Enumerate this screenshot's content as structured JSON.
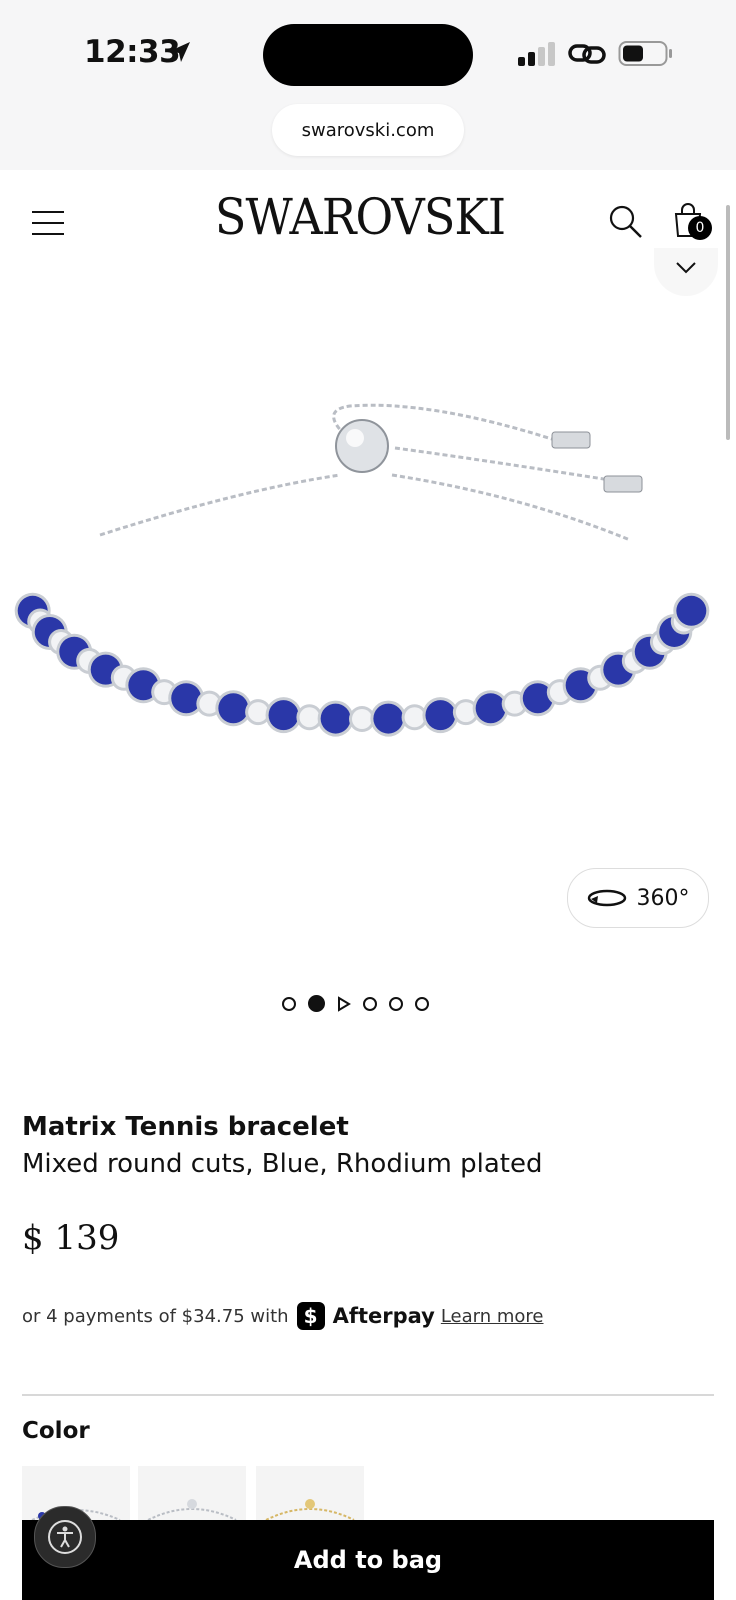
{
  "status_bar": {
    "time": "12:33",
    "url": "swarovski.com"
  },
  "header": {
    "logo": "SWAROVSKI",
    "bag_count": "0",
    "icons": [
      "menu-icon",
      "search-icon",
      "shopping-bag-icon",
      "chevron-down-icon"
    ]
  },
  "gallery": {
    "view360_label": "360°",
    "dots_total": 6,
    "active_dot": 2
  },
  "product": {
    "name": "Matrix Tennis bracelet",
    "description": "Mixed round cuts, Blue, Rhodium plated",
    "price": "$ 139"
  },
  "payments": {
    "text": "or 4 payments of $34.75 with",
    "brand": "Afterpay",
    "learn_more": "Learn more"
  },
  "color_section": {
    "label": "Color",
    "swatches": [
      "blue",
      "white",
      "gold"
    ]
  },
  "add_to_bag_label": "Add to bag",
  "colors": {
    "accent": "#000000",
    "stone_blue": "#2a37a8",
    "metal": "#c9cdd3"
  }
}
